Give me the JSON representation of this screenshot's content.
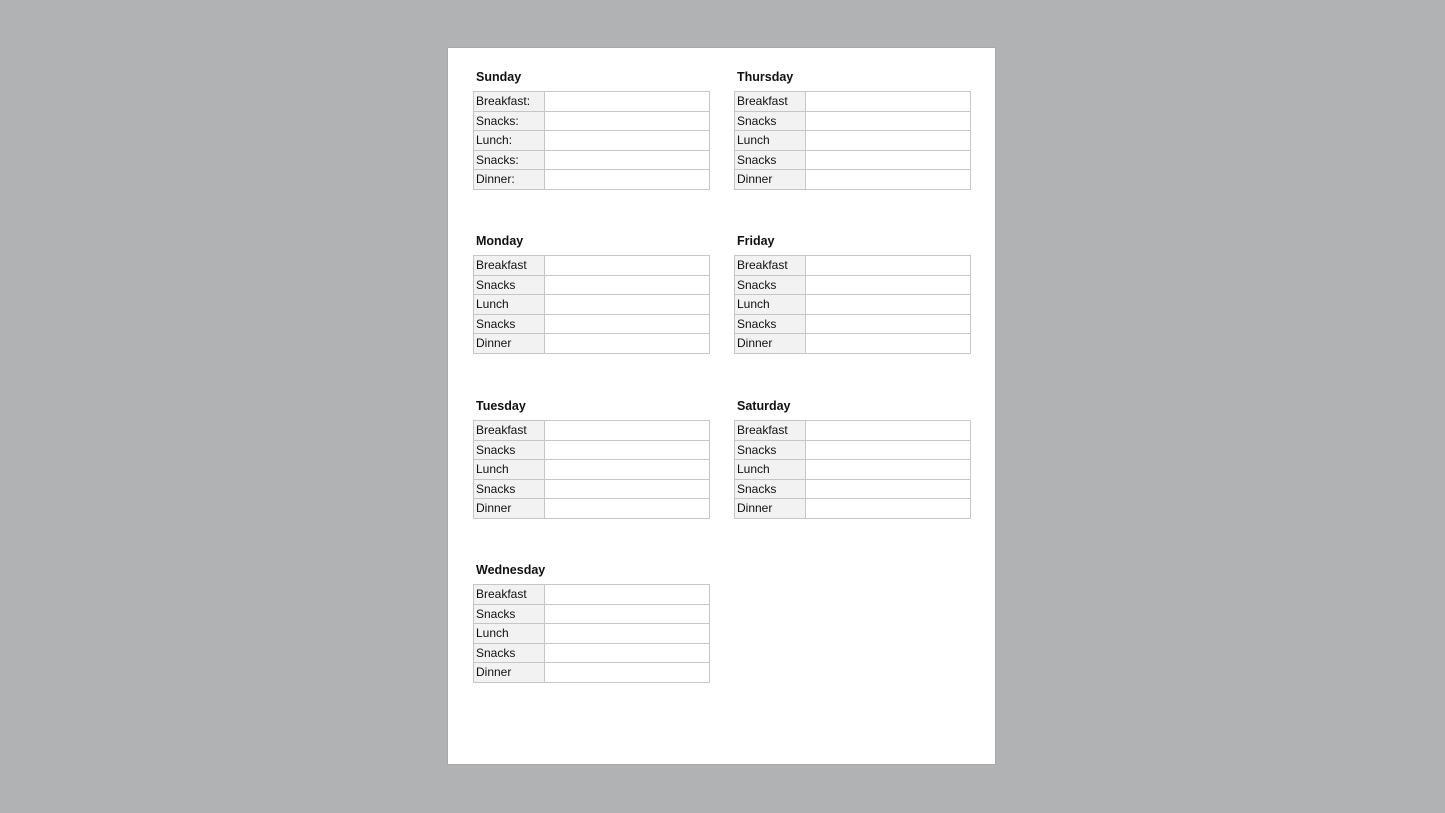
{
  "document": {
    "days": [
      {
        "name": "Sunday",
        "meals": [
          "Breakfast:",
          "Snacks:",
          "Lunch:",
          "Snacks:",
          "Dinner:"
        ],
        "values": [
          "",
          "",
          "",
          "",
          ""
        ]
      },
      {
        "name": "Monday",
        "meals": [
          "Breakfast",
          "Snacks",
          "Lunch",
          "Snacks",
          "Dinner"
        ],
        "values": [
          "",
          "",
          "",
          "",
          ""
        ]
      },
      {
        "name": "Tuesday",
        "meals": [
          "Breakfast",
          "Snacks",
          "Lunch",
          "Snacks",
          "Dinner"
        ],
        "values": [
          "",
          "",
          "",
          "",
          ""
        ]
      },
      {
        "name": "Wednesday",
        "meals": [
          "Breakfast",
          "Snacks",
          "Lunch",
          "Snacks",
          "Dinner"
        ],
        "values": [
          "",
          "",
          "",
          "",
          ""
        ]
      },
      {
        "name": "Thursday",
        "meals": [
          "Breakfast",
          "Snacks",
          "Lunch",
          "Snacks",
          "Dinner"
        ],
        "values": [
          "",
          "",
          "",
          "",
          ""
        ]
      },
      {
        "name": "Friday",
        "meals": [
          "Breakfast",
          "Snacks",
          "Lunch",
          "Snacks",
          "Dinner"
        ],
        "values": [
          "",
          "",
          "",
          "",
          ""
        ]
      },
      {
        "name": "Saturday",
        "meals": [
          "Breakfast",
          "Snacks",
          "Lunch",
          "Snacks",
          "Dinner"
        ],
        "values": [
          "",
          "",
          "",
          "",
          ""
        ]
      }
    ]
  }
}
